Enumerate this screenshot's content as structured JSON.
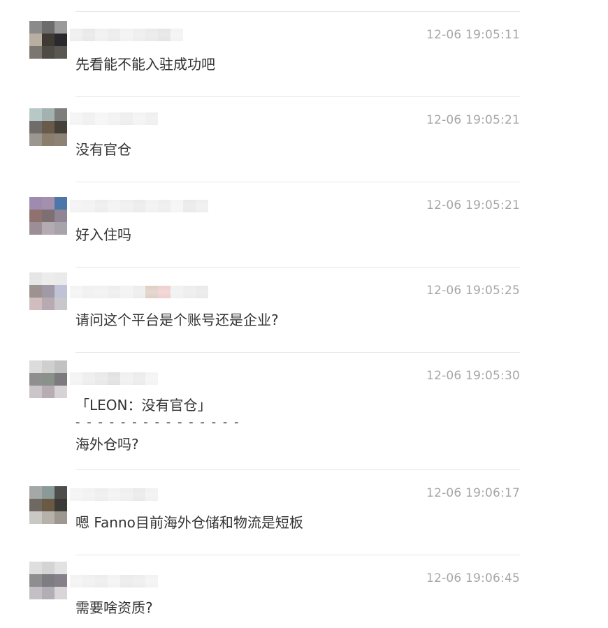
{
  "messages": [
    {
      "time": "12-06 19:05:11",
      "text": "先看能不能入驻成功吧",
      "avatar_colors": [
        "#8a8a8a",
        "#6b6b6b",
        "#9a9a9a",
        "#b9aea2",
        "#3f3a33",
        "#2a2a2e",
        "#7c7670",
        "#4e4a44",
        "#5a5752"
      ],
      "name_colors": [
        "#eaeaea",
        "#e2e2e2",
        "#ececec",
        "#e6e6e6",
        "#efefef",
        "#e9e9e9",
        "#e4e4e4",
        "#dedede",
        "#f0f0f0"
      ]
    },
    {
      "time": "12-06 19:05:21",
      "text": "没有官仓",
      "avatar_colors": [
        "#b7c9c7",
        "#a3b1b1",
        "#7e7e7c",
        "#6f6c69",
        "#6a5a4a",
        "#454038",
        "#9a9690",
        "#8a7e6c",
        "#8c8276"
      ],
      "name_colors": [
        "#f1f1f1",
        "#ececec",
        "#f3f3f3",
        "#eeeeee",
        "#e9e9e9",
        "#f0f0f0",
        "#ebebeb"
      ]
    },
    {
      "time": "12-06 19:05:21",
      "text": "好入住吗",
      "avatar_colors": [
        "#9f8bb0",
        "#a38fae",
        "#4d76a9",
        "#8f7270",
        "#7d6f72",
        "#908594",
        "#9b8e96",
        "#b4aab2",
        "#a8a2aa"
      ],
      "name_colors": [
        "#f0f0f0",
        "#eeeeee",
        "#e8e8e8",
        "#efefef",
        "#ebebeb",
        "#e6e6e6",
        "#eeeeee",
        "#e9e9e9",
        "#f2f2f2",
        "#e4e4e4",
        "#eaeaea"
      ]
    },
    {
      "time": "12-06 19:05:25",
      "text": "请问这个平台是个账号还是企业?",
      "avatar_colors": [
        "#e6e6e6",
        "#ececec",
        "#eaeaea",
        "#9d9290",
        "#a09aa6",
        "#c0c2d6",
        "#d1bcc0",
        "#b9aab2",
        "#c8c8cc"
      ],
      "name_colors": [
        "#f1f1f1",
        "#ececec",
        "#eeeeee",
        "#e9e9e9",
        "#efefef",
        "#e8e8e8",
        "#d8c4b8",
        "#ecc4c4",
        "#ededed",
        "#e8e8e8",
        "#e4e4e4"
      ]
    },
    {
      "time": "12-06 19:05:30",
      "quote": "「LEON：没有官仓」",
      "separator": "- - - - - - - - - - - - - - -",
      "text": "海外仓吗?",
      "avatar_colors": [
        "#dcdcdc",
        "#cfcfcf",
        "#c2c2c2",
        "#8f8f8f",
        "#8a908a",
        "#7c7a7e",
        "#cbc4c8",
        "#b7acb2",
        "#d6d2d6"
      ],
      "name_colors": [
        "#f0f0f0",
        "#e8e8e8",
        "#e2e2e2",
        "#d9d9d9",
        "#ececec",
        "#e6e6e6",
        "#f1f1f1"
      ]
    },
    {
      "time": "12-06 19:06:17",
      "text": "嗯 Fanno目前海外仓储和物流是短板",
      "avatar_colors": [
        "#a4a8a6",
        "#8a9a98",
        "#4e4e4c",
        "#6e6a62",
        "#6a5a44",
        "#3c3a36",
        "#cac8c4",
        "#b6b2aa",
        "#9c9890"
      ],
      "name_colors": [
        "#f1f1f1",
        "#eeeeee",
        "#e9e9e9",
        "#efefef",
        "#ebebeb",
        "#e4e4e4",
        "#eeeeee"
      ]
    },
    {
      "time": "12-06 19:06:45",
      "text": "需要啥资质?",
      "avatar_colors": [
        "#dedede",
        "#d4d4d4",
        "#e2e2e2",
        "#8e8e90",
        "#7e7e82",
        "#86808a",
        "#c2c0c4",
        "#b2aeb6",
        "#d8d6d8"
      ],
      "name_colors": [
        "#f0f0f0",
        "#ececec",
        "#e8e8e8",
        "#f0f0f0",
        "#e6e6e6",
        "#e9e9e9",
        "#f0f0f0"
      ]
    }
  ]
}
